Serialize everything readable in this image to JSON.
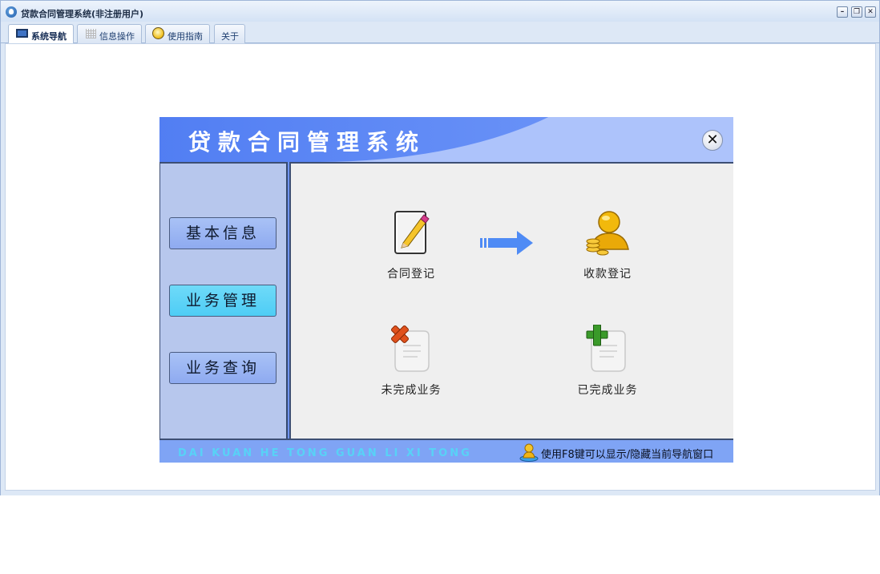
{
  "window": {
    "title": "贷款合同管理系统(非注册用户)",
    "min_symbol": "–",
    "restore_symbol": "❐",
    "close_symbol": "✕"
  },
  "tabs": [
    {
      "label": "系统导航",
      "icon": "monitor-icon",
      "active": true
    },
    {
      "label": "信息操作",
      "icon": "grid-icon",
      "active": false
    },
    {
      "label": "使用指南",
      "icon": "bulb-icon",
      "active": false
    },
    {
      "label": "关于",
      "icon": "",
      "active": false
    }
  ],
  "panel": {
    "title": "贷款合同管理系统",
    "close_symbol": "✕",
    "sidebar": [
      {
        "label": "基本信息",
        "active": false
      },
      {
        "label": "业务管理",
        "active": true
      },
      {
        "label": "业务查询",
        "active": false
      }
    ],
    "tiles": [
      {
        "label": "合同登记",
        "icon": "edit-document-icon"
      },
      {
        "label": "收款登记",
        "icon": "money-user-icon"
      },
      {
        "label": "未完成业务",
        "icon": "delete-document-icon"
      },
      {
        "label": "已完成业务",
        "icon": "add-document-icon"
      }
    ],
    "footer": {
      "subtitle": "DAI KUAN HE TONG GUAN LI XI TONG",
      "hint": "使用F8键可以显示/隐藏当前导航窗口"
    }
  },
  "colors": {
    "accent": "#4f7cf2",
    "active_button": "#4ecdf5",
    "footer_text": "#58d2f6"
  }
}
